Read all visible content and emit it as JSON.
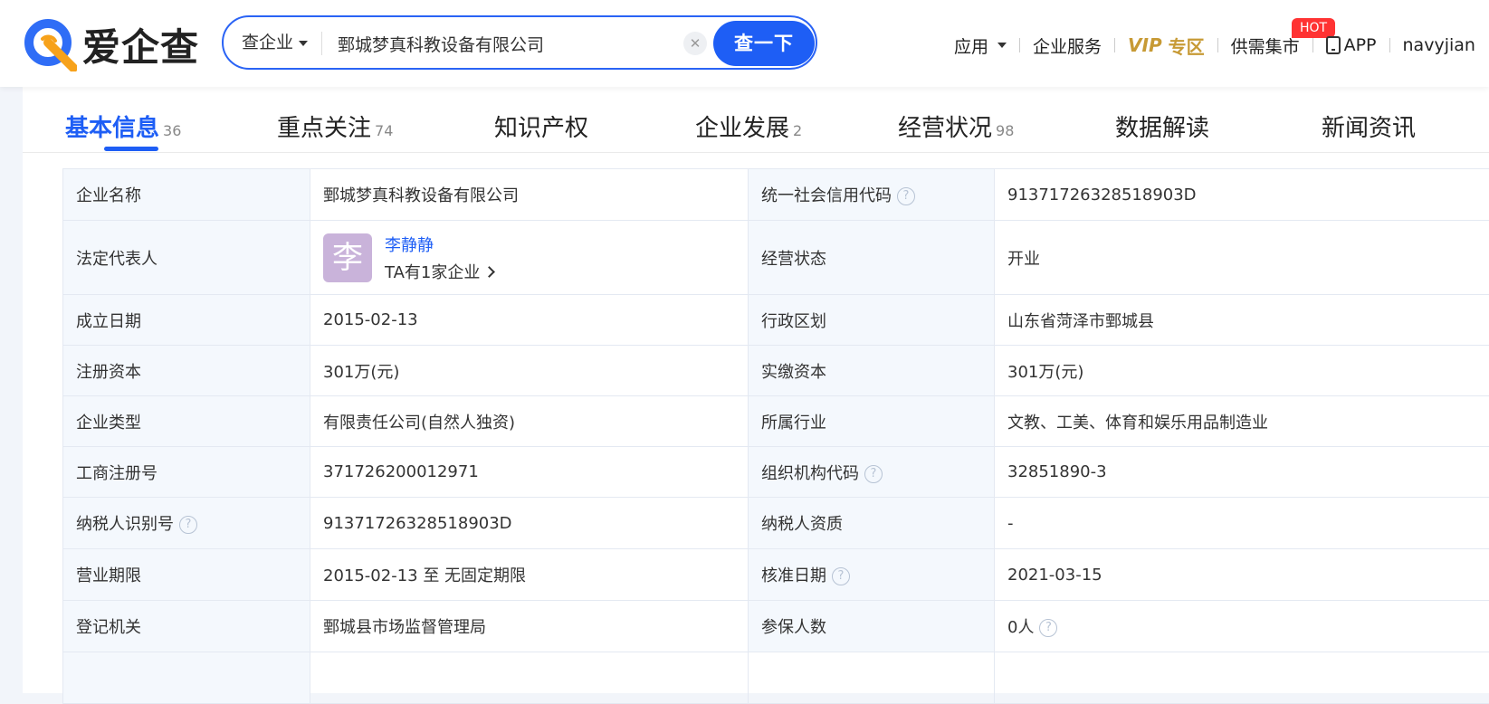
{
  "header": {
    "logo_text": "爱企查",
    "search": {
      "type": "查企业",
      "value": "鄄城梦真科教设备有限公司",
      "button": "查一下"
    },
    "nav": {
      "apps": "应用",
      "services": "企业服务",
      "vip": "VIP",
      "vip_zone": "专区",
      "market": "供需集市",
      "hot_badge": "HOT",
      "app": "APP",
      "user": "navyjian"
    }
  },
  "tabs": [
    {
      "label": "基本信息",
      "count": "36"
    },
    {
      "label": "重点关注",
      "count": "74"
    },
    {
      "label": "知识产权",
      "count": ""
    },
    {
      "label": "企业发展",
      "count": "2"
    },
    {
      "label": "经营状况",
      "count": "98"
    },
    {
      "label": "数据解读",
      "count": ""
    },
    {
      "label": "新闻资讯",
      "count": ""
    }
  ],
  "info": {
    "company_name_label": "企业名称",
    "company_name": "鄄城梦真科教设备有限公司",
    "credit_code_label": "统一社会信用代码",
    "credit_code": "91371726328518903D",
    "legal_rep_label": "法定代表人",
    "legal_rep_avatar": "李",
    "legal_rep_name": "李静静",
    "legal_rep_more": "TA有1家企业",
    "status_label": "经营状态",
    "status": "开业",
    "founded_label": "成立日期",
    "founded": "2015-02-13",
    "region_label": "行政区划",
    "region": "山东省菏泽市鄄城县",
    "reg_capital_label": "注册资本",
    "reg_capital": "301万(元)",
    "paid_capital_label": "实缴资本",
    "paid_capital": "301万(元)",
    "company_type_label": "企业类型",
    "company_type": "有限责任公司(自然人独资)",
    "industry_label": "所属行业",
    "industry": "文教、工美、体育和娱乐用品制造业",
    "reg_number_label": "工商注册号",
    "reg_number": "371726200012971",
    "org_code_label": "组织机构代码",
    "org_code": "32851890-3",
    "taxpayer_id_label": "纳税人识别号",
    "taxpayer_id": "91371726328518903D",
    "taxpayer_qual_label": "纳税人资质",
    "taxpayer_qual": "-",
    "term_label": "营业期限",
    "term": "2015-02-13 至 无固定期限",
    "approval_date_label": "核准日期",
    "approval_date": "2021-03-15",
    "authority_label": "登记机关",
    "authority": "鄄城县市场监督管理局",
    "insured_label": "参保人数",
    "insured": "0人"
  },
  "colors": {
    "brand_blue": "#1e5ef5",
    "logo_orange": "#f7a21b",
    "vip_gold": "#c79a35",
    "hot_red": "#ff3333"
  }
}
